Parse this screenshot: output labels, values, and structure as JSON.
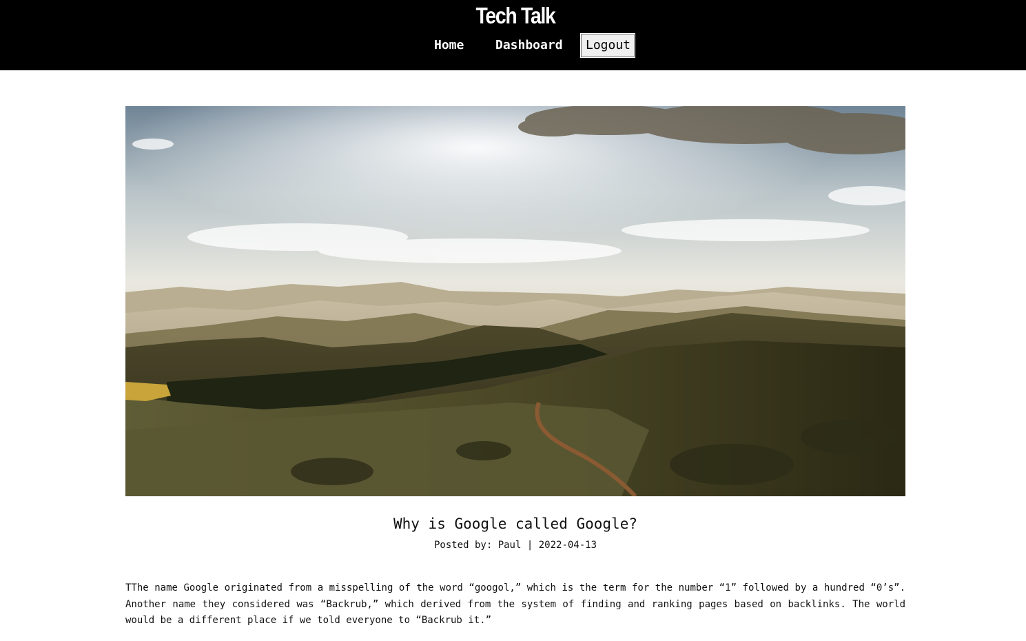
{
  "header": {
    "site_title": "Tech Talk",
    "nav": {
      "home": "Home",
      "dashboard": "Dashboard",
      "logout": "Logout"
    },
    "background_color": "#000000"
  },
  "post": {
    "title": "Why is Google called Google?",
    "meta": {
      "prefix": "Posted by:",
      "author": "Paul",
      "separator": "|",
      "date": "2022-04-13"
    },
    "body": "TThe name Google originated from a misspelling of the word “googol,” which is the term for the number “1” followed by a hundred “0’s”. Another name they considered was “Backrub,” which derived from the system of finding and ranking pages based on backlinks. The world would be a different place if we told everyone to “Backrub it.”"
  }
}
